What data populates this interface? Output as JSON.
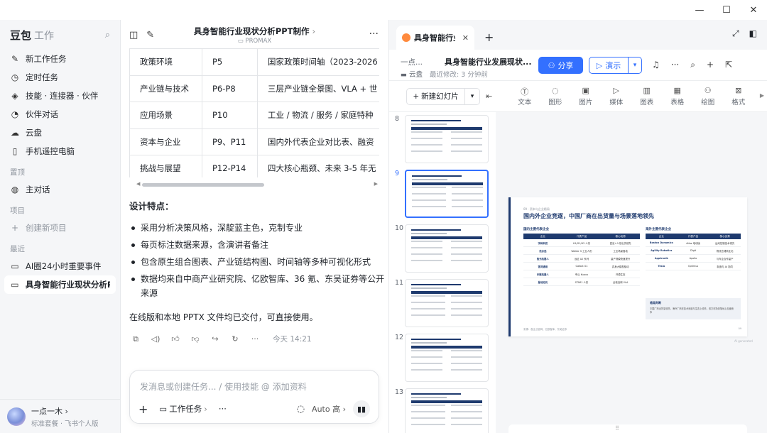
{
  "window": {
    "min": "—",
    "max": "☐",
    "close": "✕"
  },
  "sidebar": {
    "brand": "豆包",
    "brand_sub": "工作",
    "items": [
      {
        "icon": "new-task-icon",
        "glyph": "✎",
        "label": "新工作任务"
      },
      {
        "icon": "clock-icon",
        "glyph": "◷",
        "label": "定时任务"
      },
      {
        "icon": "layers-icon",
        "glyph": "◈",
        "label": "技能 · 连接器 · 伙伴"
      },
      {
        "icon": "chat-bubble-icon",
        "glyph": "◔",
        "label": "伙伴对话"
      },
      {
        "icon": "cloud-icon",
        "glyph": "☁",
        "label": "云盘"
      },
      {
        "icon": "phone-icon",
        "glyph": "▯",
        "label": "手机遥控电脑"
      }
    ],
    "pinned_label": "置顶",
    "pinned": [
      {
        "label": "主对话"
      }
    ],
    "projects_label": "项目",
    "new_project": "创建新项目",
    "recent_label": "最近",
    "recent": [
      {
        "label": "AI圈24小时重要事件"
      },
      {
        "label": "具身智能行业现状分析PPT"
      }
    ],
    "user": {
      "name": "一点一木",
      "sub": "标准套餐 · 飞书个人版"
    }
  },
  "chat": {
    "title": "具身智能行业现状分析PPT制作",
    "subtitle": "PROMAX",
    "table": [
      [
        "政策环境",
        "P5",
        "国家政策时间轴（2023-2026"
      ],
      [
        "产业链与技术",
        "P6-P8",
        "三层产业链全景图、VLA + 世"
      ],
      [
        "应用场景",
        "P10",
        "工业 / 物流 / 服务 / 家庭特种"
      ],
      [
        "资本与企业",
        "P9、P11",
        "国内外代表企业对比表、融资"
      ],
      [
        "挑战与展望",
        "P12-P14",
        "四大核心瓶颈、未来 3-5 年无"
      ]
    ],
    "design_title": "设计特点：",
    "bullets": [
      "采用分析决策风格，深靛蓝主色，克制专业",
      "每页标注数据来源，含演讲者备注",
      "包含原生组合图表、产业链结构图、时间轴等多种可视化形式",
      "数据均来自中商产业研究院、亿欧智库、36 氪、东吴证券等公开来源"
    ],
    "done_text": "在线版和本地 PPTX 文件均已交付，可直接使用。",
    "time": "今天 14:21",
    "input_placeholder": "发消息或创建任务... / 使用技能 @ 添加资料",
    "work_task": "工作任务",
    "auto": "Auto 高"
  },
  "doc": {
    "tab_title": "具身智能行业",
    "crumb": "一点...",
    "doc_name": "具身智能行业发展现状...",
    "location": "云盘",
    "modified": "最近修改: 3 分钟前",
    "share": "分享",
    "present": "演示",
    "new_slide": "新建幻灯片",
    "tools": [
      "文本",
      "图形",
      "图片",
      "媒体",
      "图表",
      "表格",
      "绘图",
      "格式"
    ],
    "thumb_numbers": [
      "8",
      "9",
      "10",
      "11",
      "12",
      "13"
    ],
    "selected_thumb": "9",
    "slide": {
      "kicker": "09 · 资本与企业格局",
      "title": "国内外企业竞逐，中国厂商在出货量与场景落地领先",
      "left_panel": "国内主要代表企业",
      "right_panel": "海外主要代表企业",
      "left_cols": [
        "企业",
        "代表产品",
        "核心优势"
      ],
      "right_cols": [
        "企业",
        "代表产品",
        "核心优势"
      ],
      "left_rows": [
        [
          "宇树科技",
          "H1/G1/H2 人形",
          "四足+人形出货领先"
        ],
        [
          "优必选",
          "Walker S 工业人形",
          "工业场景落地"
        ],
        [
          "智元机器人",
          "远征 A2 系列",
          "量产规模快速提升"
        ],
        [
          "银河通用",
          "Galbot G1",
          "具身大模型驱动"
        ],
        [
          "乐聚机器人",
          "夸父 Kuavo",
          "开源生态"
        ],
        [
          "星动纪元",
          "STAR1 人形",
          "全栈自研 VLA"
        ]
      ],
      "right_rows": [
        [
          "Boston Dynamics",
          "Atlas 电动版",
          "运动控制技术领先"
        ],
        [
          "Agility Robotics",
          "Digit",
          "物流仓储商业化"
        ],
        [
          "Apptronik",
          "Apollo",
          "与车企合作量产"
        ],
        [
          "Tesla",
          "Optimus",
          "制造与 AI 协同"
        ]
      ],
      "note_title": "格局判断",
      "note_text": "中国厂商出货量领先，海外厂商在技术深度与生态上领先，双方在场景落地上加速竞争",
      "footer": "来源：各企业官网、亿欧智库、东吴证券",
      "page": "09"
    },
    "ai_generated": "AI generated"
  }
}
